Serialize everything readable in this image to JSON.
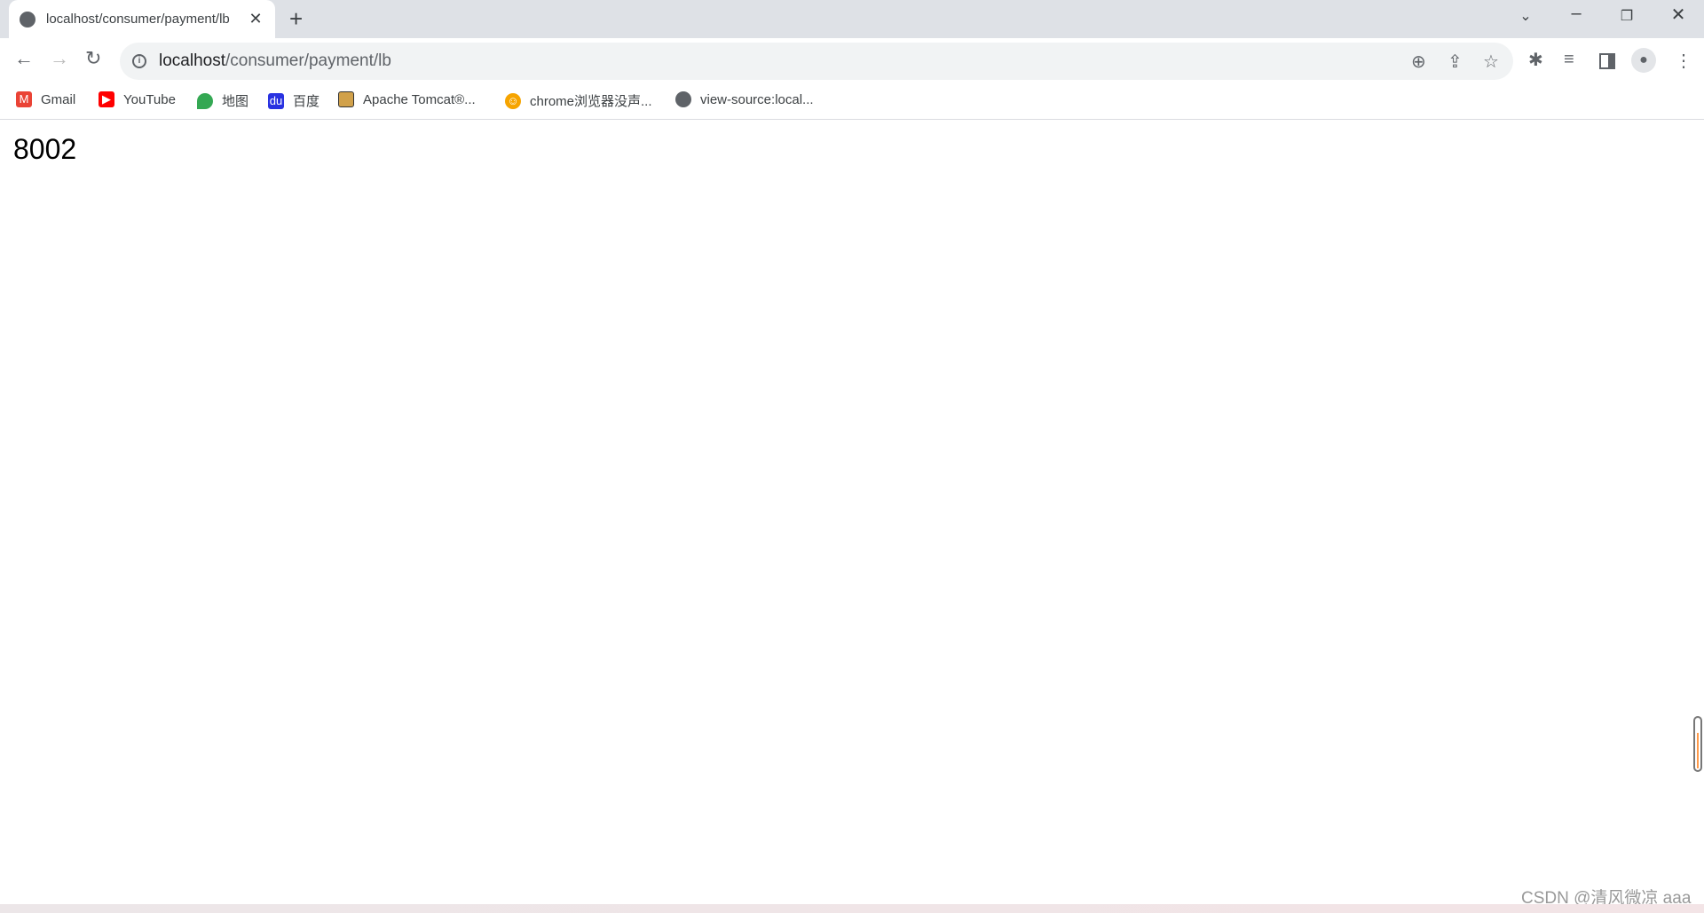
{
  "browser": {
    "tab_title": "localhost/consumer/payment/lb",
    "url_host": "localhost",
    "url_path": "/consumer/payment/lb",
    "bookmarks": [
      {
        "label": "Gmail",
        "icon": "gmail-icon",
        "color": "#ea4335"
      },
      {
        "label": "YouTube",
        "icon": "youtube-icon",
        "color": "#ff0000"
      },
      {
        "label": "地图",
        "icon": "maps-icon",
        "color": "#34a853"
      },
      {
        "label": "百度",
        "icon": "baidu-icon",
        "color": "#2932e1"
      },
      {
        "label": "Apache Tomcat®...",
        "icon": "tomcat-icon",
        "color": "#d1a14a"
      },
      {
        "label": "chrome浏览器没声...",
        "icon": "smiley-icon",
        "color": "#f6a400"
      },
      {
        "label": "view-source:local...",
        "icon": "globe-icon",
        "color": "#5f6368"
      }
    ]
  },
  "page": {
    "content": "8002"
  },
  "watermark": "CSDN @清风微凉 aaa"
}
